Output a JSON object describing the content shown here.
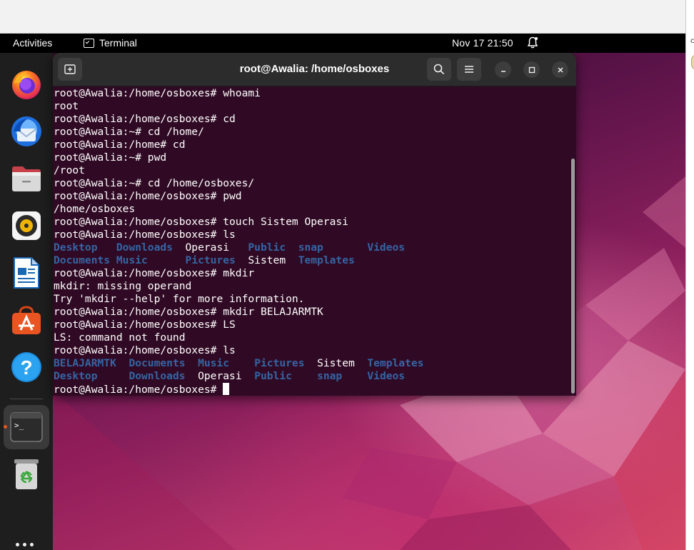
{
  "topbar": {
    "activities": "Activities",
    "app_name": "Terminal",
    "clock": "Nov 17  21:50",
    "bell_icon": "bell-icon"
  },
  "host": {
    "fragment": "c"
  },
  "dock": {
    "items": [
      {
        "name": "Firefox",
        "icon": "firefox-icon"
      },
      {
        "name": "Thunderbird",
        "icon": "thunderbird-icon"
      },
      {
        "name": "Files",
        "icon": "files-icon"
      },
      {
        "name": "Rhythmbox",
        "icon": "rhythmbox-icon"
      },
      {
        "name": "LibreOffice Writer",
        "icon": "writer-icon"
      },
      {
        "name": "Ubuntu Software",
        "icon": "software-icon"
      },
      {
        "name": "Help",
        "icon": "help-icon"
      },
      {
        "name": "Terminal",
        "icon": "terminal-icon"
      },
      {
        "name": "Trash",
        "icon": "trash-icon"
      }
    ],
    "help_glyph": "?",
    "terminal_glyph": ">_"
  },
  "window": {
    "title": "root@Awalia: /home/osboxes",
    "colors": {
      "background": "#300a24",
      "directory": "#3465a4",
      "text": "#ffffff"
    }
  },
  "terminal": {
    "lines": [
      [
        {
          "t": "root@Awalia:/home/osboxes# whoami"
        }
      ],
      [
        {
          "t": "root"
        }
      ],
      [
        {
          "t": "root@Awalia:/home/osboxes# cd"
        }
      ],
      [
        {
          "t": "root@Awalia:~# cd /home/"
        }
      ],
      [
        {
          "t": "root@Awalia:/home# cd"
        }
      ],
      [
        {
          "t": "root@Awalia:~# pwd"
        }
      ],
      [
        {
          "t": "/root"
        }
      ],
      [
        {
          "t": "root@Awalia:~# cd /home/osboxes/"
        }
      ],
      [
        {
          "t": "root@Awalia:/home/osboxes# pwd"
        }
      ],
      [
        {
          "t": "/home/osboxes"
        }
      ],
      [
        {
          "t": "root@Awalia:/home/osboxes# touch Sistem Operasi"
        }
      ],
      [
        {
          "t": "root@Awalia:/home/osboxes# ls"
        }
      ],
      [
        {
          "t": "Desktop",
          "c": "dir"
        },
        {
          "t": "   "
        },
        {
          "t": "Downloads",
          "c": "dir"
        },
        {
          "t": "  Operasi   "
        },
        {
          "t": "Public",
          "c": "dir"
        },
        {
          "t": "  "
        },
        {
          "t": "snap",
          "c": "dir"
        },
        {
          "t": "       "
        },
        {
          "t": "Videos",
          "c": "dir"
        }
      ],
      [
        {
          "t": "Documents",
          "c": "dir"
        },
        {
          "t": " "
        },
        {
          "t": "Music",
          "c": "dir"
        },
        {
          "t": "      "
        },
        {
          "t": "Pictures",
          "c": "dir"
        },
        {
          "t": "  Sistem  "
        },
        {
          "t": "Templates",
          "c": "dir"
        }
      ],
      [
        {
          "t": "root@Awalia:/home/osboxes# mkdir"
        }
      ],
      [
        {
          "t": "mkdir: missing operand"
        }
      ],
      [
        {
          "t": "Try 'mkdir --help' for more information."
        }
      ],
      [
        {
          "t": "root@Awalia:/home/osboxes# mkdir BELAJARMTK"
        }
      ],
      [
        {
          "t": "root@Awalia:/home/osboxes# LS"
        }
      ],
      [
        {
          "t": "LS: command not found"
        }
      ],
      [
        {
          "t": "root@Awalia:/home/osboxes# ls"
        }
      ],
      [
        {
          "t": "BELAJARMTK",
          "c": "dir"
        },
        {
          "t": "  "
        },
        {
          "t": "Documents",
          "c": "dir"
        },
        {
          "t": "  "
        },
        {
          "t": "Music",
          "c": "dir"
        },
        {
          "t": "    "
        },
        {
          "t": "Pictures",
          "c": "dir"
        },
        {
          "t": "  Sistem  "
        },
        {
          "t": "Templates",
          "c": "dir"
        }
      ],
      [
        {
          "t": "Desktop",
          "c": "dir"
        },
        {
          "t": "     "
        },
        {
          "t": "Downloads",
          "c": "dir"
        },
        {
          "t": "  Operasi  "
        },
        {
          "t": "Public",
          "c": "dir"
        },
        {
          "t": "    "
        },
        {
          "t": "snap",
          "c": "dir"
        },
        {
          "t": "    "
        },
        {
          "t": "Videos",
          "c": "dir"
        }
      ],
      [
        {
          "t": "root@Awalia:/home/osboxes# "
        },
        {
          "t": "",
          "c": "cursor"
        }
      ]
    ]
  }
}
